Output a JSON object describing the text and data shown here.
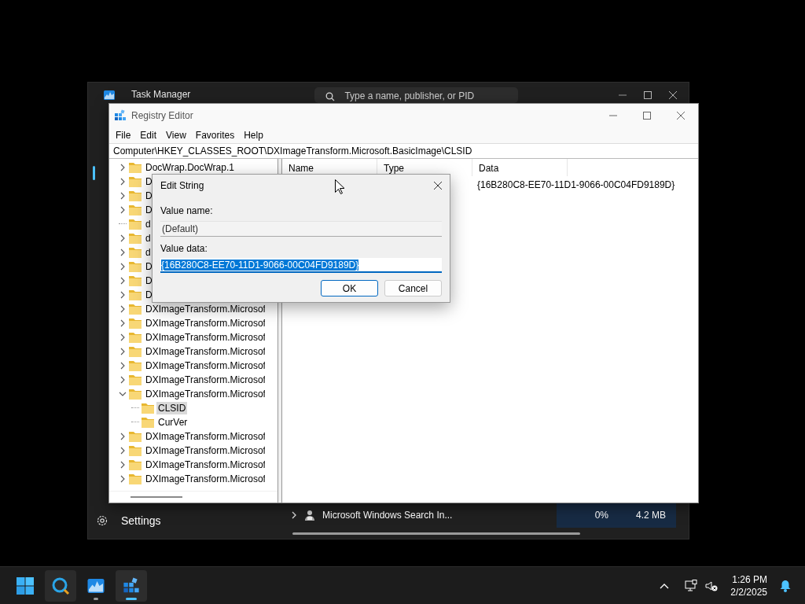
{
  "task_manager": {
    "title": "Task Manager",
    "search": {
      "placeholder": "Type a name, publisher, or PID"
    },
    "settings": "Settings",
    "process_row": {
      "name": "Microsoft Windows Search In...",
      "cpu": "0%",
      "memory": "4.2 MB"
    }
  },
  "registry_editor": {
    "title": "Registry Editor",
    "menu": [
      "File",
      "Edit",
      "View",
      "Favorites",
      "Help"
    ],
    "address": "Computer\\HKEY_CLASSES_ROOT\\DXImageTransform.Microsoft.BasicImage\\CLSID",
    "tree": [
      {
        "label": "DocWrap.DocWrap.1",
        "has_children": true,
        "expanded": false,
        "selected": false
      },
      {
        "label": "D",
        "has_children": true,
        "expanded": false,
        "selected": false
      },
      {
        "label": "D",
        "has_children": true,
        "expanded": false,
        "selected": false
      },
      {
        "label": "D",
        "has_children": true,
        "expanded": false,
        "selected": false
      },
      {
        "label": "d",
        "has_children": false,
        "selected": false
      },
      {
        "label": "d",
        "has_children": true,
        "expanded": false,
        "selected": false
      },
      {
        "label": "d",
        "has_children": true,
        "expanded": false,
        "selected": false
      },
      {
        "label": "D",
        "has_children": true,
        "expanded": false,
        "selected": false
      },
      {
        "label": "D",
        "has_children": true,
        "expanded": false,
        "selected": false
      },
      {
        "label": "D",
        "has_children": true,
        "expanded": false,
        "selected": false
      },
      {
        "label": "DXImageTransform.Microsof",
        "has_children": true,
        "expanded": false,
        "selected": false
      },
      {
        "label": "DXImageTransform.Microsof",
        "has_children": true,
        "expanded": false,
        "selected": false
      },
      {
        "label": "DXImageTransform.Microsof",
        "has_children": true,
        "expanded": false,
        "selected": false
      },
      {
        "label": "DXImageTransform.Microsof",
        "has_children": true,
        "expanded": false,
        "selected": false
      },
      {
        "label": "DXImageTransform.Microsof",
        "has_children": true,
        "expanded": false,
        "selected": false
      },
      {
        "label": "DXImageTransform.Microsof",
        "has_children": true,
        "expanded": false,
        "selected": false
      },
      {
        "label": "DXImageTransform.Microsof",
        "has_children": true,
        "expanded": true,
        "selected": false,
        "children": [
          {
            "label": "CLSID",
            "has_children": false,
            "selected": true
          },
          {
            "label": "CurVer",
            "has_children": false,
            "selected": false
          }
        ]
      },
      {
        "label": "DXImageTransform.Microsof",
        "has_children": true,
        "expanded": false,
        "selected": false
      },
      {
        "label": "DXImageTransform.Microsof",
        "has_children": true,
        "expanded": false,
        "selected": false
      },
      {
        "label": "DXImageTransform.Microsof",
        "has_children": true,
        "expanded": false,
        "selected": false
      },
      {
        "label": "DXImageTransform.Microsof",
        "has_children": true,
        "expanded": false,
        "selected": false
      }
    ],
    "columns": [
      "Name",
      "Type",
      "Data"
    ],
    "rows": [
      {
        "data": "{16B280C8-EE70-11D1-9066-00C04FD9189D}"
      }
    ]
  },
  "edit_string_dialog": {
    "title": "Edit String",
    "value_name_label": "Value name:",
    "value_name": "(Default)",
    "value_data_label": "Value data:",
    "value_data": {
      "value": "{16B280C8-EE70-11D1-9066-00C04FD9189D}",
      "text_selected": true
    },
    "buttons": [
      {
        "label": "OK",
        "default": true
      },
      {
        "label": "Cancel",
        "default": false
      }
    ]
  },
  "taskbar": {
    "apps": [
      {
        "kind": "start",
        "hovered": false,
        "running": false,
        "active": false
      },
      {
        "kind": "search",
        "hovered": true,
        "running": false,
        "active": false
      },
      {
        "kind": "task-manager",
        "hovered": false,
        "running": true,
        "active": false
      },
      {
        "kind": "registry-editor",
        "hovered": false,
        "running": true,
        "active": true
      }
    ],
    "time": "1:26 PM",
    "date": "2/2/2025"
  }
}
